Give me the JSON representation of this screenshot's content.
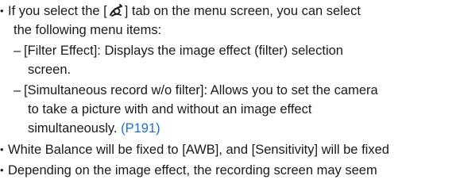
{
  "paragraphs": [
    {
      "type": "bullet",
      "line1_pre": "If you select the [",
      "icon": "creative-brush-icon",
      "line1_post": "] tab on the menu screen, you can select",
      "line2": "the following menu items:"
    },
    {
      "type": "dash",
      "line1": "[Filter Effect]: Displays the image effect (filter) selection",
      "line2": "screen."
    },
    {
      "type": "dash",
      "line1": "[Simultaneous record w/o filter]: Allows you to set the camera",
      "line2": "to take a picture with and without an image effect",
      "line3_text": "simultaneously. ",
      "line3_link": "(P191)"
    },
    {
      "type": "bullet",
      "line1": "White Balance will be fixed to [AWB], and [Sensitivity] will be fixed"
    },
    {
      "type": "bullet",
      "line1": "Depending on the image effect, the recording screen may seem"
    }
  ],
  "colors": {
    "text": "#1a1a1a",
    "link": "#1f6fd1"
  }
}
